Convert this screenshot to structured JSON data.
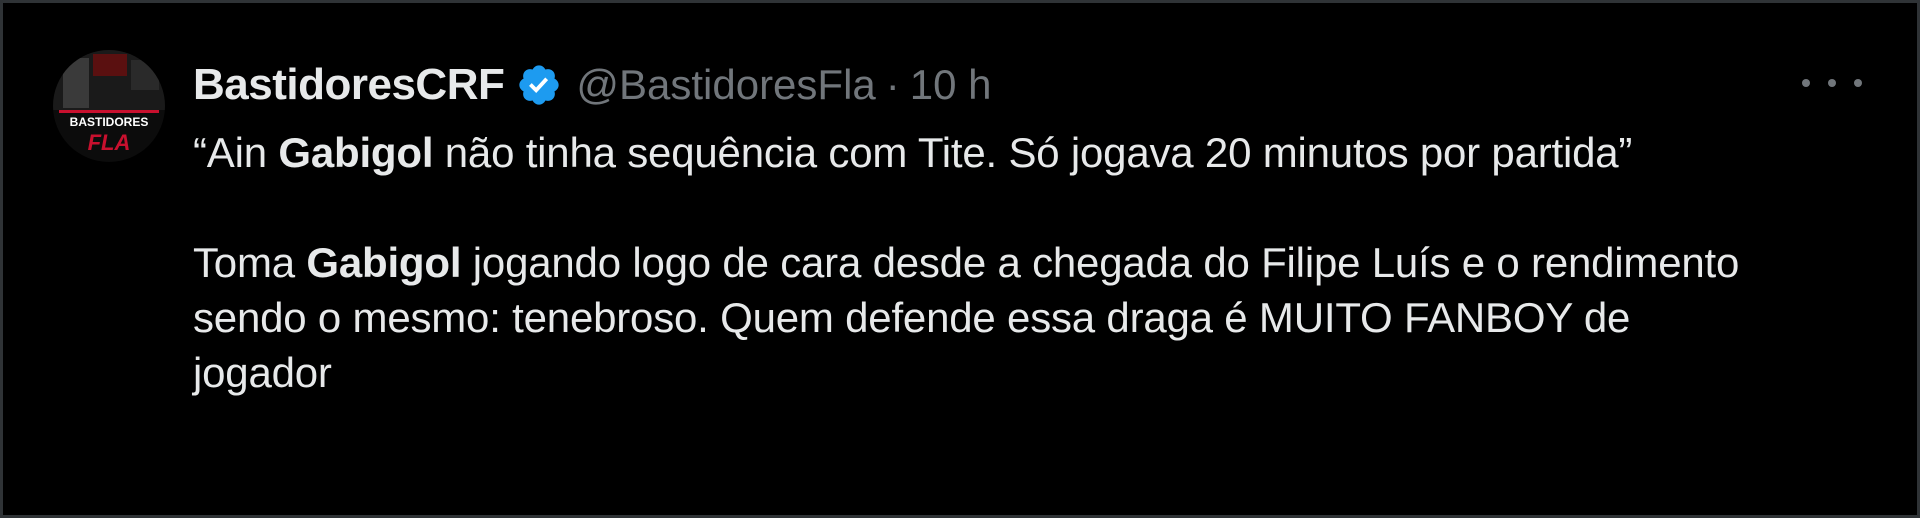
{
  "tweet": {
    "display_name": "BastidoresCRF",
    "handle": "@BastidoresFla",
    "separator": "·",
    "timestamp": "10 h",
    "verified_icon": "verified-badge-icon",
    "more_icon": "more-horizontal-icon",
    "avatar_text": [
      "BASTIDORES",
      "FLA"
    ],
    "paragraph_1": {
      "prefix": "“Ain ",
      "bold": "Gabigol",
      "suffix": " não tinha sequência com Tite. Só jogava 20 minutos por partida”"
    },
    "paragraph_2": {
      "prefix": "Toma ",
      "bold": "Gabigol",
      "suffix": " jogando logo de cara desde a chegada do Filipe Luís e o rendimento sendo o mesmo: tenebroso. Quem defende essa draga é MUITO FANBOY de jogador"
    }
  },
  "colors": {
    "background": "#000000",
    "border": "#2f3336",
    "primary_text": "#e7e9ea",
    "secondary_text": "#71767b",
    "verified_blue": "#1d9bf0",
    "avatar_red": "#c8102e"
  }
}
